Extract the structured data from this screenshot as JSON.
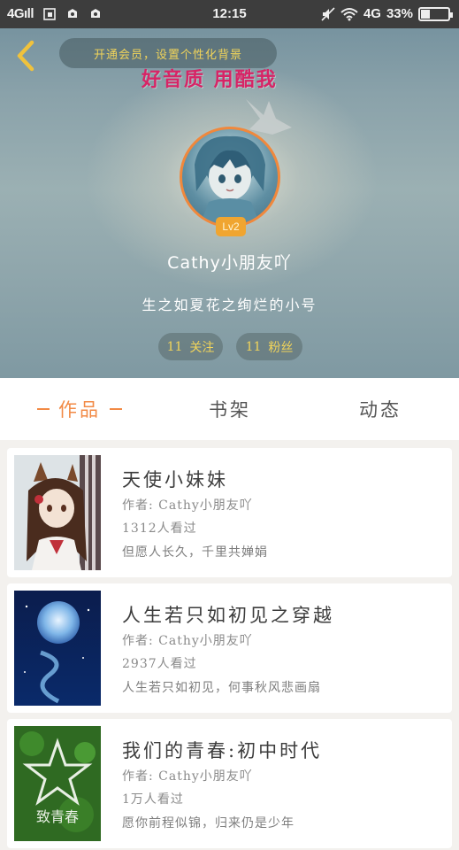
{
  "status_bar": {
    "signal": "4Gıll",
    "time": "12:15",
    "network": "4G",
    "battery_percent": "33%",
    "battery_level": 0.33
  },
  "header": {
    "member_banner": "开通会员，设置个性化背景",
    "promo_text": "好音质 用酷我",
    "level_badge": "Lv2",
    "username": "Cathy小朋友吖",
    "signature": "生之如夏花之绚烂的小号",
    "follow_count": "11",
    "follow_label": "关注",
    "fans_count": "11",
    "fans_label": "粉丝"
  },
  "tabs": [
    {
      "label": "作品",
      "active": true
    },
    {
      "label": "书架",
      "active": false
    },
    {
      "label": "动态",
      "active": false
    }
  ],
  "works": [
    {
      "title": "天使小妹妹",
      "author": "作者: Cathy小朋友吖",
      "views": "1312人看过",
      "description": "但愿人长久，千里共婵娟"
    },
    {
      "title": "人生若只如初见之穿越",
      "author": "作者: Cathy小朋友吖",
      "views": "2937人看过",
      "description": "人生若只如初见，何事秋风悲画扇"
    },
    {
      "title": "我们的青春:初中时代",
      "author": "作者: Cathy小朋友吖",
      "views": "1万人看过",
      "description": "愿你前程似锦，归来仍是少年",
      "cover_text": "致青春"
    }
  ],
  "colors": {
    "accent": "#f28a45",
    "promo": "#d72466",
    "pill_text": "#f1d45a"
  }
}
